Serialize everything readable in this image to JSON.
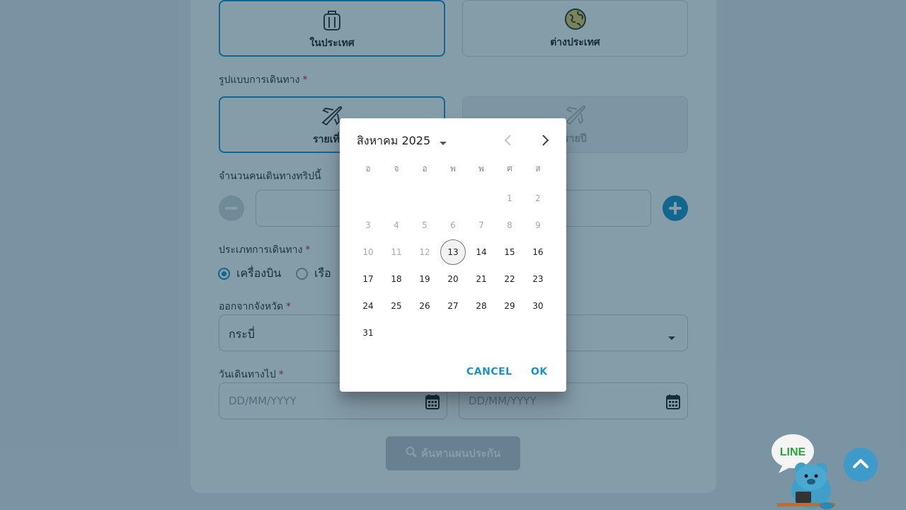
{
  "scope": {
    "domestic": "ในประเทศ",
    "international": "ต่างประเทศ"
  },
  "trip_type": {
    "label": "รูปแบบการเดินทาง",
    "per_trip": "รายเที่ยว",
    "annual": "รายปี"
  },
  "travelers": {
    "label": "จำนวนคนเดินทางทริปนี้"
  },
  "travel_mode": {
    "label": "ประเภทการเดินทาง",
    "options": [
      "เครื่องบิน",
      "เรือ"
    ],
    "selected": "เครื่องบิน"
  },
  "province": {
    "label": "ออกจากจังหวัด",
    "value": "กระบี่"
  },
  "departure": {
    "label": "วันเดินทางไป",
    "placeholder": "DD/MM/YYYY"
  },
  "return_date": {
    "placeholder": "DD/MM/YYYY"
  },
  "search_button": "ค้นหาแผนประกัน",
  "mascot_label": "LINE",
  "date_picker": {
    "month_title": "สิงหาคม 2025",
    "weekdays": [
      "อ",
      "จ",
      "อ",
      "พ",
      "พ",
      "ศ",
      "ส"
    ],
    "first_weekday_index": 5,
    "days_in_month": 31,
    "today": 13,
    "first_enabled_day": 13,
    "cancel": "CANCEL",
    "ok": "OK"
  },
  "colors": {
    "accent": "#1a93c9",
    "required": "#d4202f",
    "overlay": "#0b3953"
  },
  "icons": {
    "domestic": "luggage-icon",
    "international": "globe-icon",
    "per_trip": "airplane-icon",
    "annual": "airplane-icon",
    "calendar": "calendar-icon",
    "search": "search-icon",
    "scroll_top": "chevron-up-icon"
  }
}
